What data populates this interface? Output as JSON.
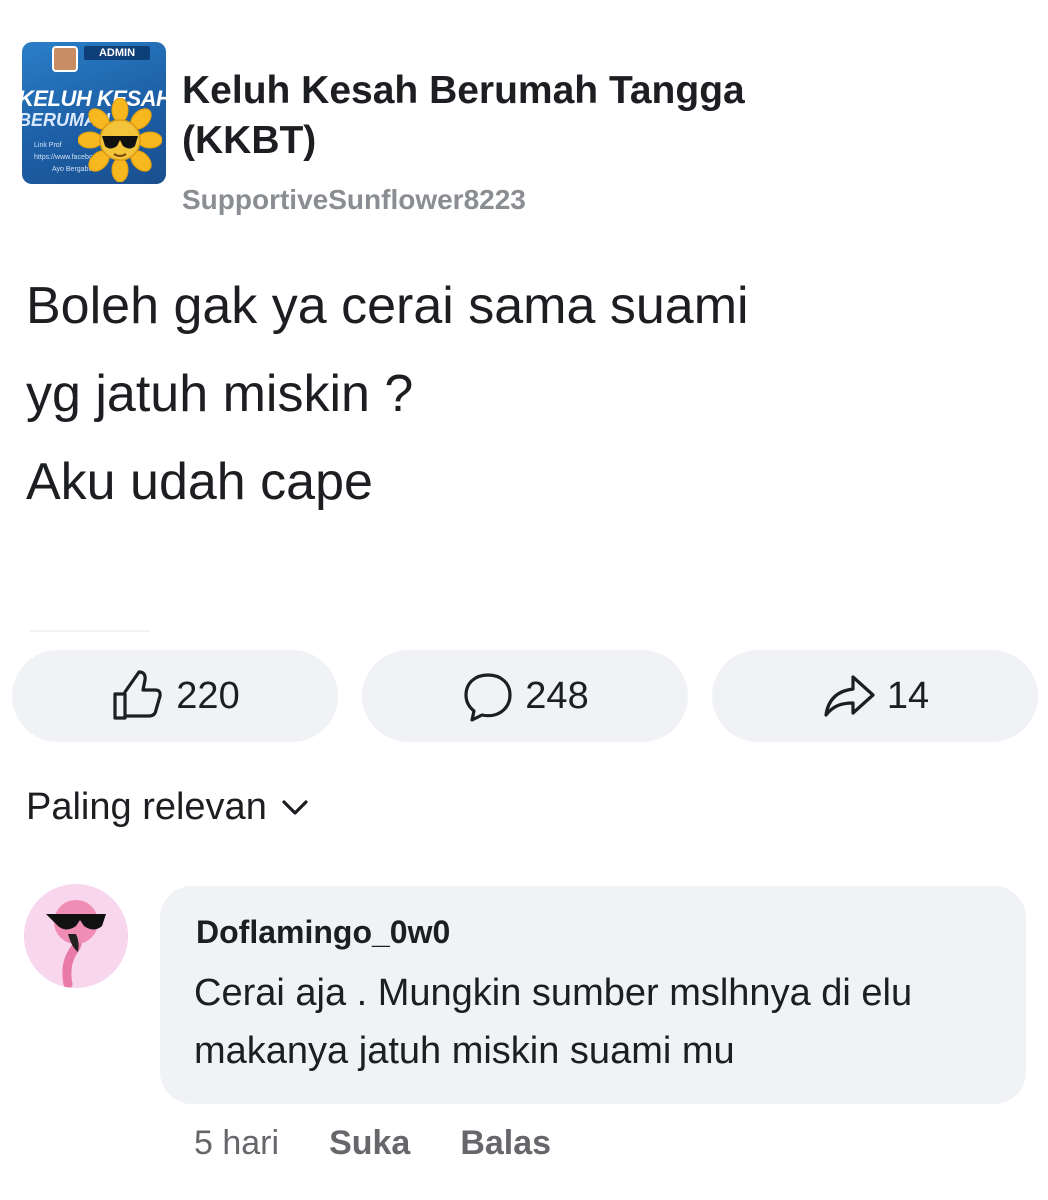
{
  "group": {
    "avatar_admin_label": "ADMIN",
    "avatar_banner_line1": "KELUH KESAH",
    "avatar_banner_line2": "BERUMAH",
    "avatar_small_1": "Link Prof",
    "avatar_small_2": "https://www.facebook",
    "avatar_small_3": "Ayo Bergabun",
    "name": "Keluh Kesah Berumah Tangga (KKBT)",
    "author": "SupportiveSunflower8223"
  },
  "post": {
    "lines": [
      "Boleh gak ya cerai sama suami",
      "yg jatuh miskin ?",
      "Aku udah cape"
    ]
  },
  "actions": {
    "like_count": "220",
    "comment_count": "248",
    "share_count": "14"
  },
  "sort": {
    "label": "Paling relevan"
  },
  "comment": {
    "author": "Doflamingo_0w0",
    "text": "Cerai aja . Mungkin sumber mslhnya di elu makanya jatuh miskin suami mu",
    "time": "5 hari",
    "like_label": "Suka",
    "reply_label": "Balas"
  },
  "colors": {
    "button_bg": "#f0f2f5",
    "secondary_text": "#65676b",
    "author_text": "#8a8d91"
  }
}
